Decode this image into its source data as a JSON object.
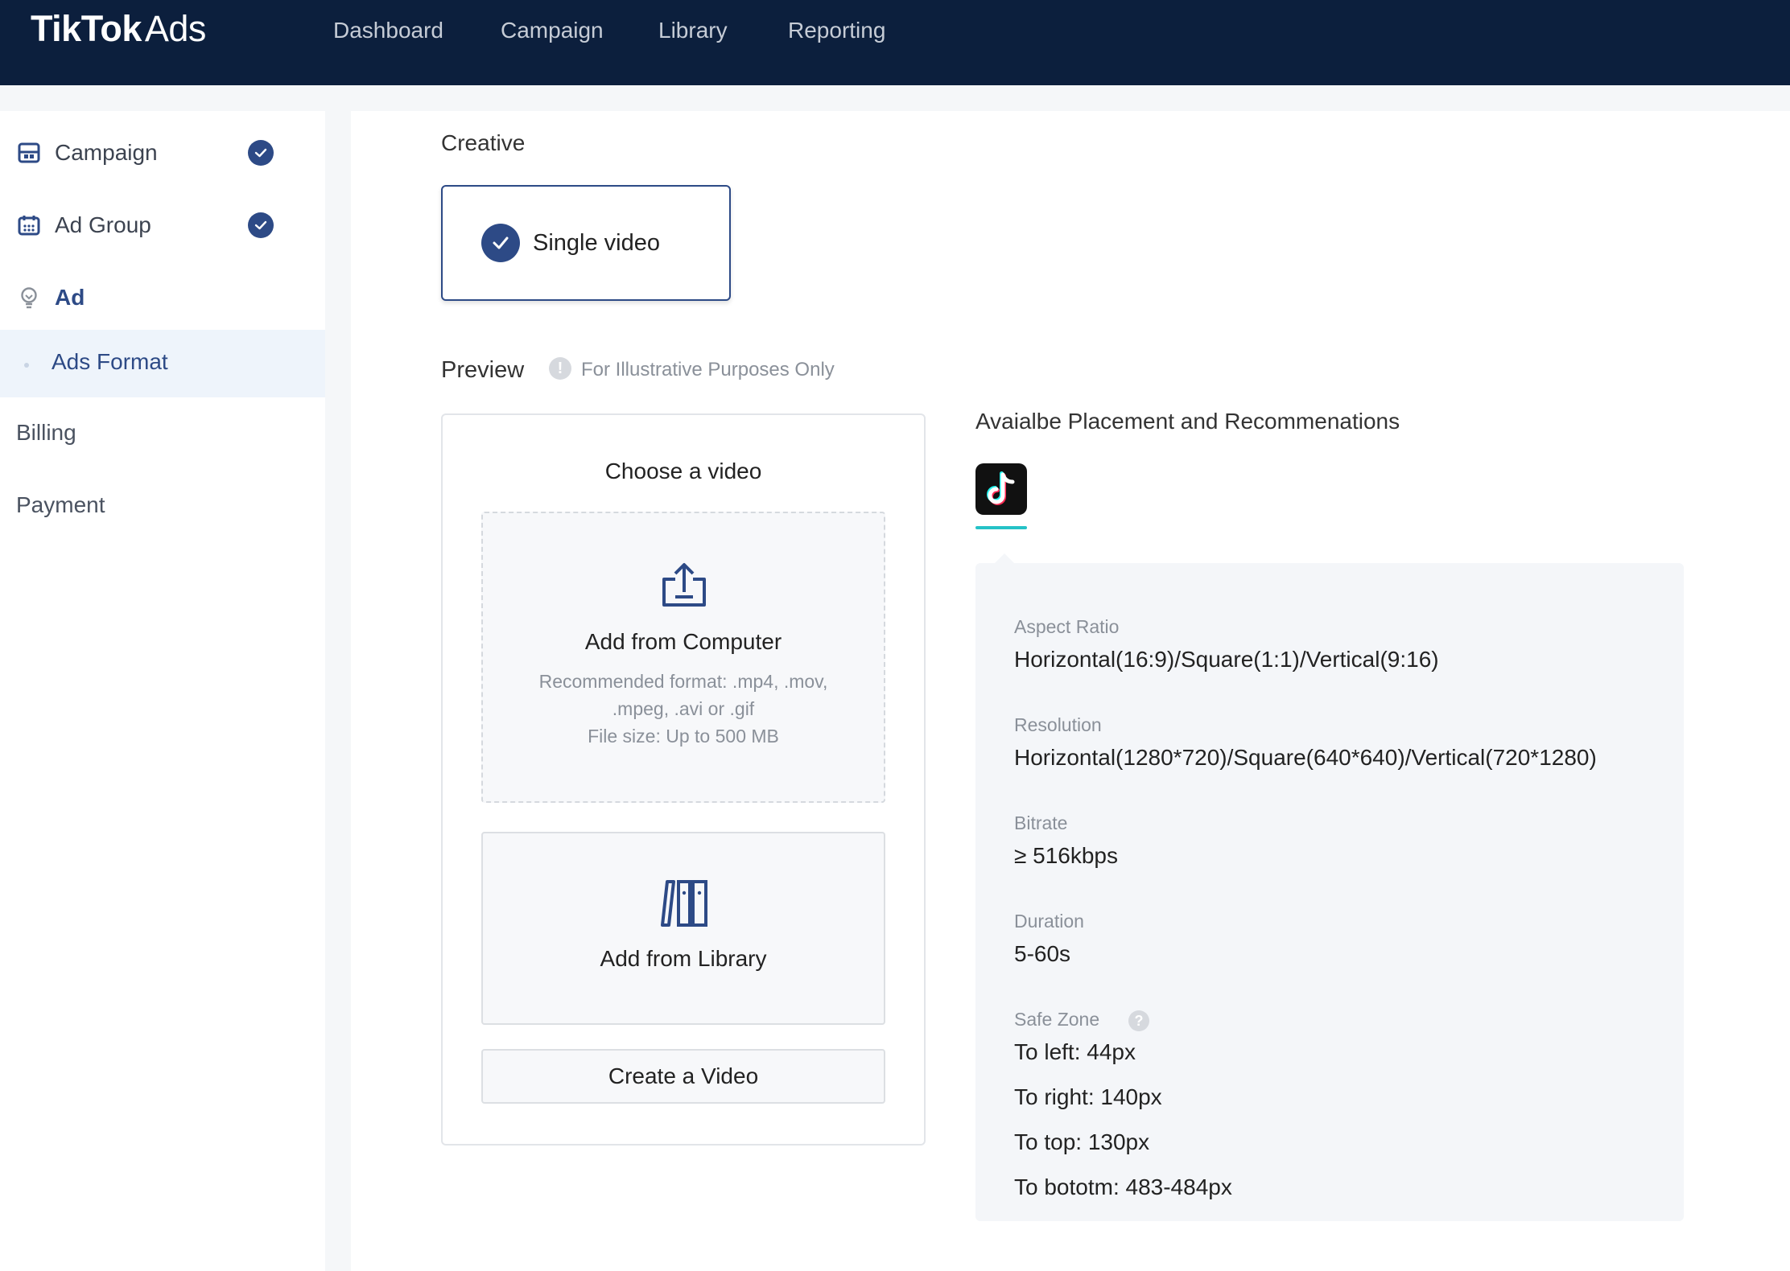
{
  "header": {
    "brand": "TikTok",
    "brand_suffix": "Ads",
    "nav": [
      "Dashboard",
      "Campaign",
      "Library",
      "Reporting"
    ]
  },
  "sidebar": {
    "items": [
      {
        "label": "Campaign",
        "icon": "layout-icon",
        "done": true
      },
      {
        "label": "Ad Group",
        "icon": "calendar-icon",
        "done": true
      },
      {
        "label": "Ad",
        "icon": "lightbulb-icon",
        "active": true
      }
    ],
    "sub_item": "Ads Format",
    "billing": "Billing",
    "payment": "Payment"
  },
  "creative": {
    "title": "Creative",
    "option": "Single video"
  },
  "preview": {
    "title": "Preview",
    "note": "For Illustrative Purposes Only",
    "choose_title": "Choose a video",
    "computer": {
      "title": "Add from Computer",
      "hint_lines": [
        "Recommended format: .mp4, .mov,",
        ".mpeg, .avi or .gif",
        "File size: Up to 500 MB"
      ]
    },
    "library_title": "Add from Library",
    "create_label": "Create a Video"
  },
  "placement": {
    "title": "Avaialbe Placement and Recommenations",
    "specs": {
      "aspect_label": "Aspect Ratio",
      "aspect_value": "Horizontal(16:9)/Square(1:1)/Vertical(9:16)",
      "resolution_label": "Resolution",
      "resolution_value": "Horizontal(1280*720)/Square(640*640)/Vertical(720*1280)",
      "bitrate_label": "Bitrate",
      "bitrate_value": "≥ 516kbps",
      "duration_label": "Duration",
      "duration_value": "5-60s",
      "safezone_label": "Safe Zone",
      "safezone_values": [
        "To left: 44px",
        "To right: 140px",
        "To top: 130px",
        "To bototm: 483-484px"
      ]
    }
  },
  "colors": {
    "header_bg": "#0c1f3d",
    "accent": "#2d4a86",
    "tiktok_underline": "#25c2c7"
  }
}
